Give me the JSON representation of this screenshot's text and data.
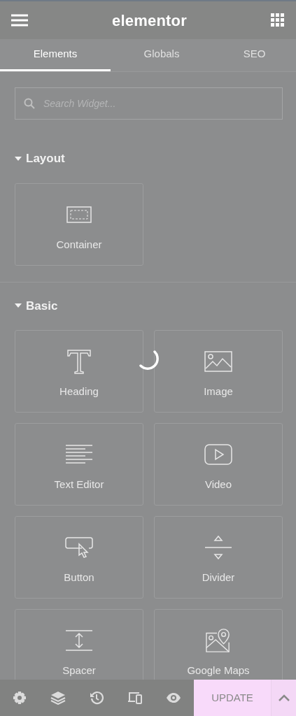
{
  "header": {
    "title": "elementor"
  },
  "tabs": [
    {
      "label": "Elements",
      "selected": true
    },
    {
      "label": "Globals",
      "selected": false
    },
    {
      "label": "SEO",
      "selected": false
    }
  ],
  "search": {
    "placeholder": "Search Widget..."
  },
  "loading": true,
  "categories": [
    {
      "title": "Layout",
      "expanded": true,
      "widgets": [
        {
          "kind": "container",
          "label": "Container"
        }
      ]
    },
    {
      "title": "Basic",
      "expanded": true,
      "widgets": [
        {
          "kind": "heading",
          "label": "Heading"
        },
        {
          "kind": "image",
          "label": "Image"
        },
        {
          "kind": "text",
          "label": "Text Editor"
        },
        {
          "kind": "video",
          "label": "Video"
        },
        {
          "kind": "button",
          "label": "Button"
        },
        {
          "kind": "divider",
          "label": "Divider"
        },
        {
          "kind": "spacer",
          "label": "Spacer"
        },
        {
          "kind": "map",
          "label": "Google Maps"
        }
      ]
    }
  ],
  "footer": {
    "tools": [
      {
        "kind": "settings"
      },
      {
        "kind": "layers"
      },
      {
        "kind": "history"
      },
      {
        "kind": "responsive"
      },
      {
        "kind": "preview"
      }
    ],
    "update": "UPDATE"
  }
}
